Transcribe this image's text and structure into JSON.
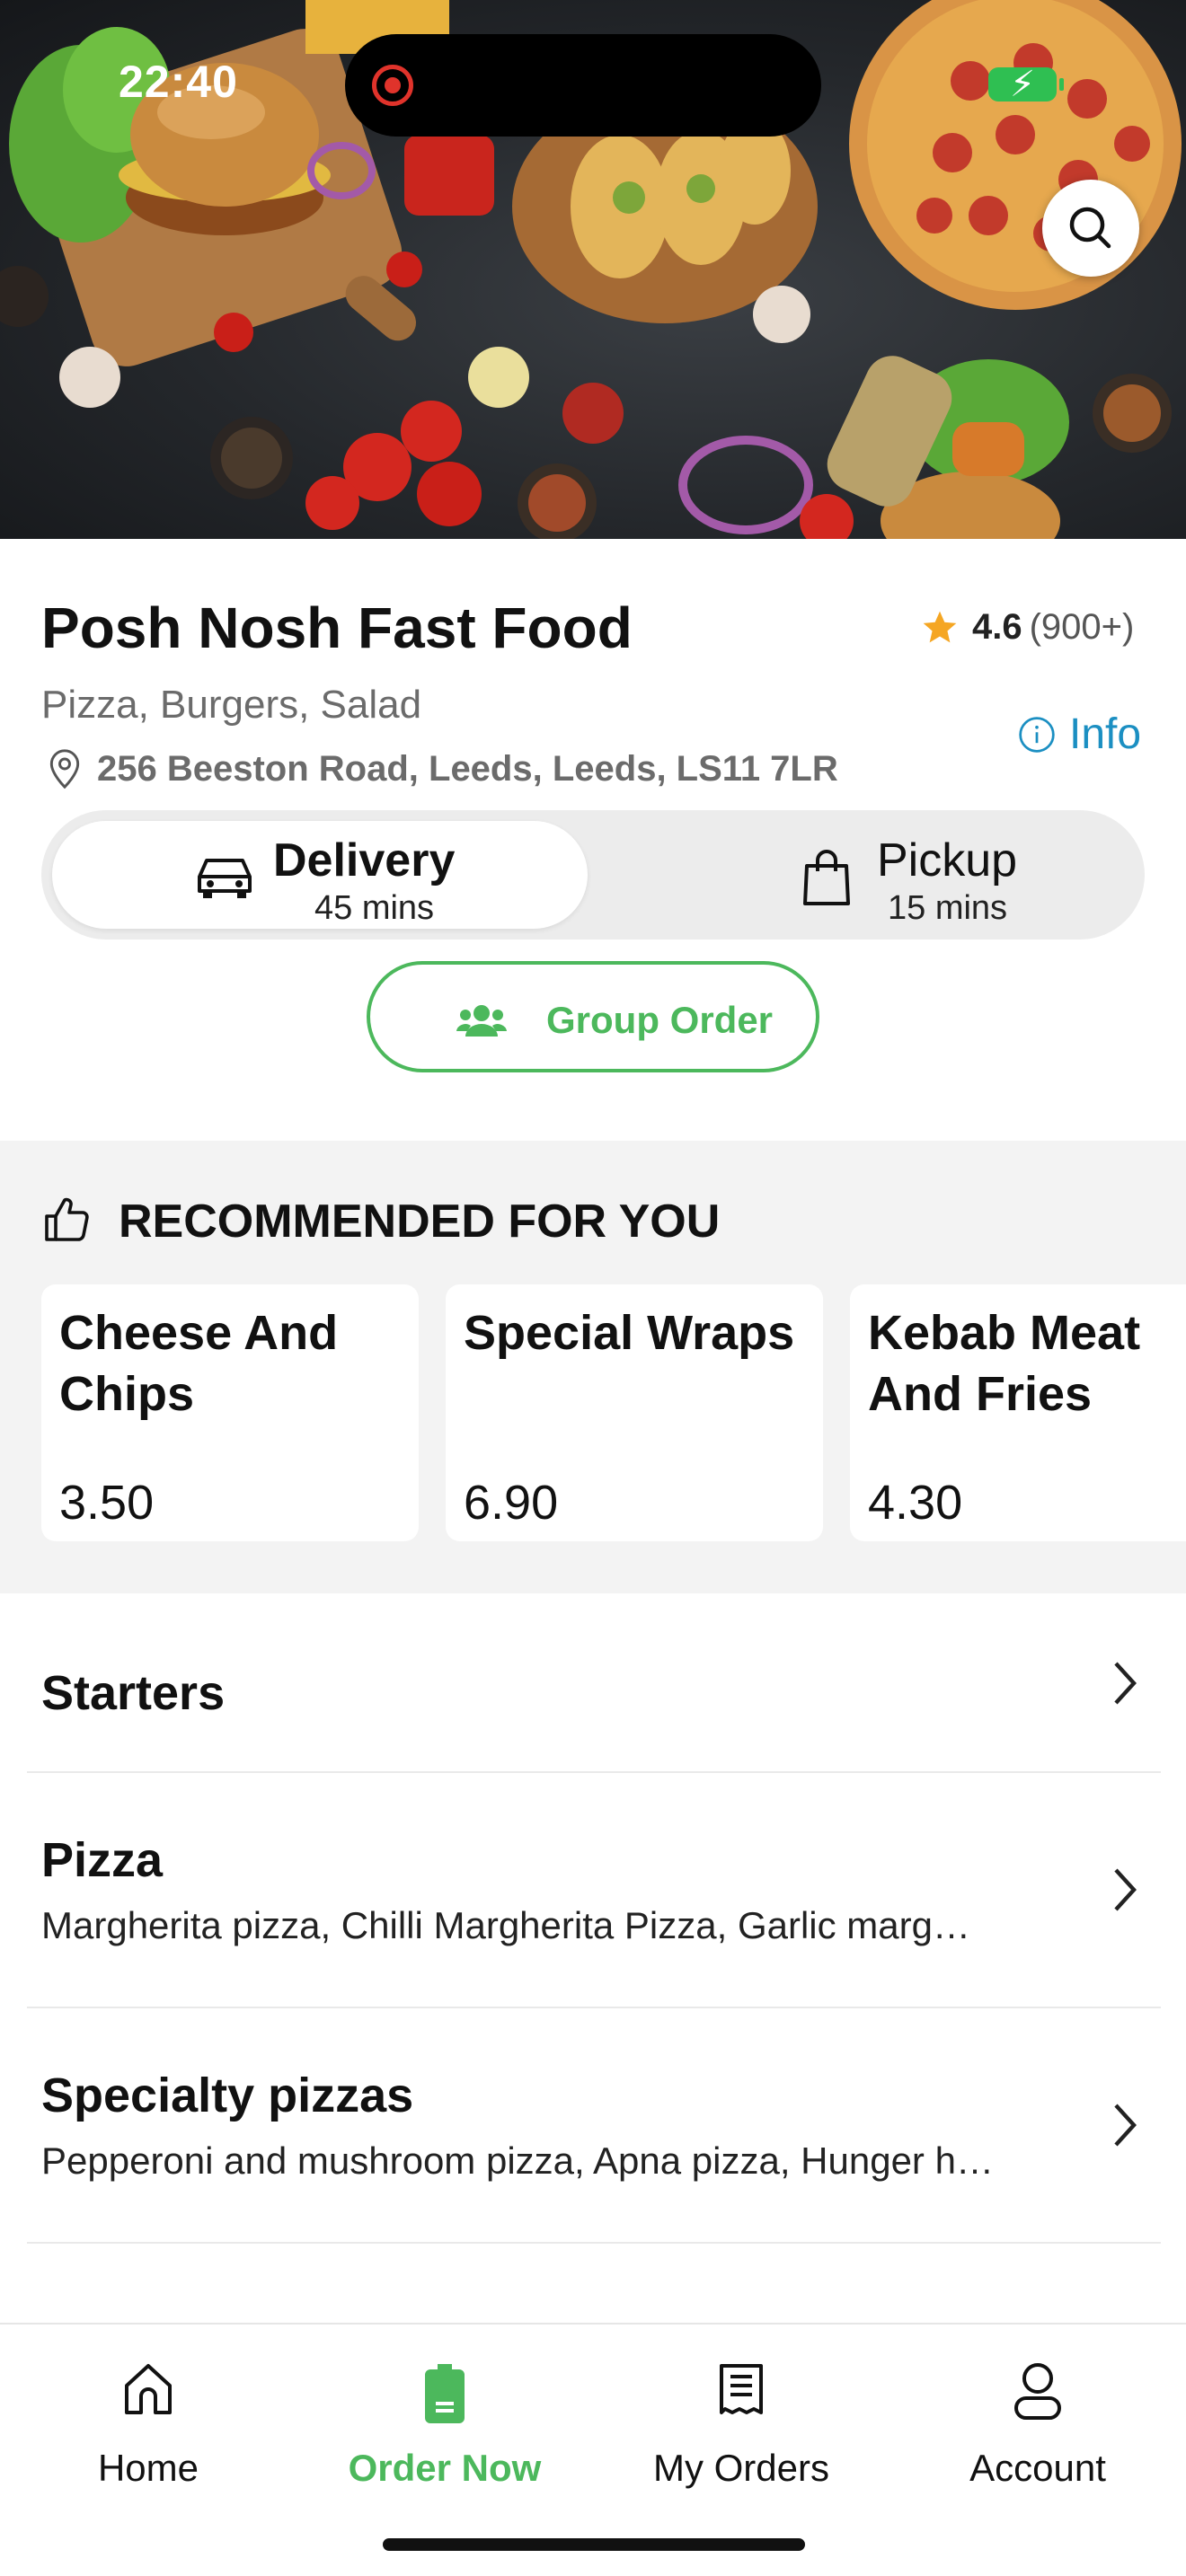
{
  "status_bar": {
    "time": "22:40"
  },
  "store": {
    "name": "Posh Nosh Fast Food",
    "rating": "4.6",
    "rating_count": "(900+)",
    "cuisines": "Pizza, Burgers, Salad",
    "info_label": "Info",
    "address": "256 Beeston Road, Leeds, Leeds, LS11 7LR"
  },
  "order_modes": {
    "delivery": {
      "label": "Delivery",
      "time": "45 mins",
      "selected": true
    },
    "pickup": {
      "label": "Pickup",
      "time": "15 mins",
      "selected": false
    }
  },
  "group_order": {
    "label": "Group Order"
  },
  "recommended": {
    "title": "RECOMMENDED FOR YOU",
    "items": [
      {
        "name": "Cheese And Chips",
        "price": "3.50"
      },
      {
        "name": "Special Wraps",
        "price": "6.90"
      },
      {
        "name": "Kebab Meat And Fries For…",
        "price": "4.30"
      }
    ]
  },
  "categories": [
    {
      "name": "Starters",
      "description": ""
    },
    {
      "name": "Pizza",
      "description": "Margherita pizza, Chilli Margherita Pizza, Garlic marg…"
    },
    {
      "name": "Specialty pizzas",
      "description": "Pepperoni and mushroom pizza, Apna pizza, Hunger h…"
    }
  ],
  "bottom_nav": {
    "items": [
      {
        "label": "Home",
        "icon": "home-icon"
      },
      {
        "label": "Order Now",
        "icon": "order-icon",
        "active": true
      },
      {
        "label": "My Orders",
        "icon": "receipt-icon"
      },
      {
        "label": "Account",
        "icon": "user-icon"
      }
    ]
  },
  "colors": {
    "accent": "#4cb85c",
    "link": "#1b8fc2",
    "star": "#f5a623"
  }
}
